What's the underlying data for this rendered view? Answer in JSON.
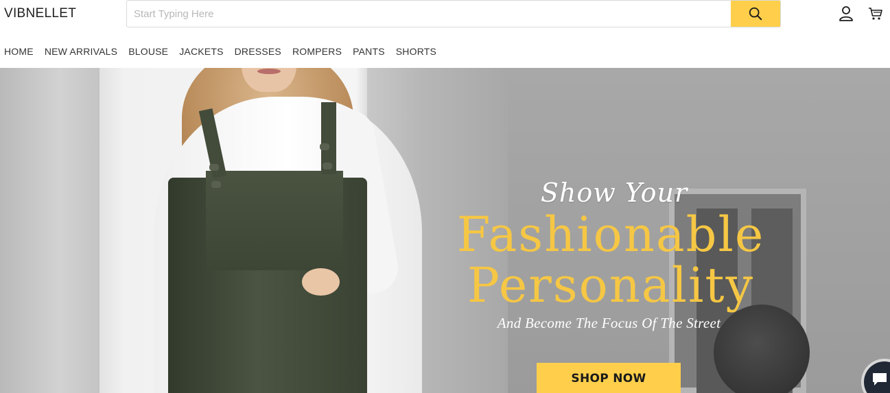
{
  "header": {
    "logo": "VIBNELLET",
    "search": {
      "placeholder": "Start Typing Here",
      "value": ""
    }
  },
  "nav": {
    "items": [
      {
        "label": "HOME"
      },
      {
        "label": "NEW ARRIVALS"
      },
      {
        "label": "BLOUSE"
      },
      {
        "label": "JACKETS"
      },
      {
        "label": "DRESSES"
      },
      {
        "label": "ROMPERS"
      },
      {
        "label": "PANTS"
      },
      {
        "label": "SHORTS"
      }
    ]
  },
  "hero": {
    "script_heading": "Show Your",
    "heading_line1": "Fashionable",
    "heading_line2": "Personality",
    "tagline": "And Become The Focus Of The Street",
    "cta_label": "SHOP NOW"
  },
  "colors": {
    "accent": "#ffcf4b",
    "heading_gold": "#f6c744",
    "chat_bg": "#202836"
  },
  "icons": {
    "search": "search-icon",
    "account": "user-icon",
    "cart": "cart-icon",
    "chat": "chat-icon"
  }
}
